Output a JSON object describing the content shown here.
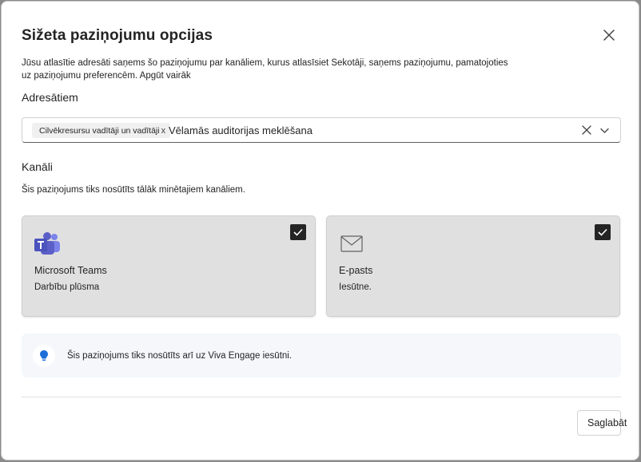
{
  "dialog": {
    "title": "Sižeta paziņojumu opcijas",
    "description": "Jūsu atlasītie adresāti saņems šo paziņojumu par kanāliem, kurus atlasīsiet Sekotāji, saņems paziņojumu, pamatojoties uz paziņojumu preferencēm.",
    "learn_more": "Apgūt vairāk",
    "close_icon": "close-icon"
  },
  "recipients": {
    "label": "Adresātiem",
    "tag": "Cilvēkresursu vadītāji un vadītāji",
    "tag_remove": "x",
    "input_value": "Vēlamās auditorijas meklēšana"
  },
  "channels": {
    "label": "Kanāli",
    "subtitle": "Šis paziņojums tiks nosūtīts tālāk minētajiem kanāliem.",
    "items": [
      {
        "name": "Microsoft Teams",
        "sub": "Darbību plūsma",
        "icon": "teams-icon",
        "checked": true
      },
      {
        "name": "E-pasts",
        "sub": "Iesūtne.",
        "icon": "mail-icon",
        "checked": true
      }
    ]
  },
  "info": {
    "text": "Šis paziņojums tiks nosūtīts arī uz Viva Engage iesūtni.",
    "icon": "lightbulb-icon"
  },
  "footer": {
    "save_label": "Saglabāt"
  },
  "colors": {
    "card_bg": "#e0e0e0",
    "teams_purple": "#5b5fc7",
    "bulb_blue": "#1d6fd8"
  }
}
